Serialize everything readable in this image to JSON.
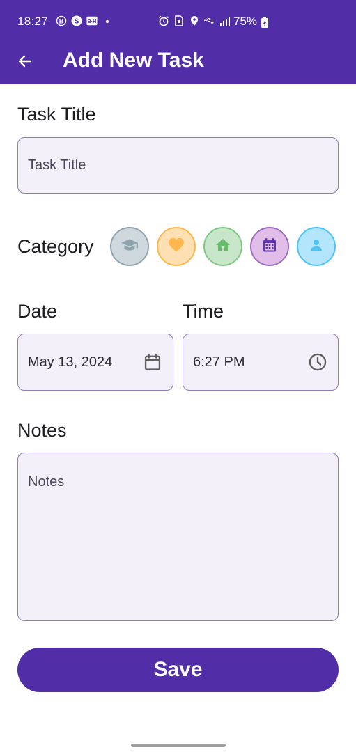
{
  "status_bar": {
    "time": "18:27",
    "battery": "75%",
    "left_icons": [
      "b-circle-icon",
      "s-circle-icon",
      "bh-box-icon",
      "dot-icon"
    ],
    "right_icons": [
      "alarm-icon",
      "sim-lock-icon",
      "location-icon",
      "4g-icon",
      "signal-icon"
    ]
  },
  "app_bar": {
    "title": "Add New Task",
    "back_icon": "arrow-left-icon"
  },
  "task_title": {
    "label": "Task Title",
    "placeholder": "Task Title"
  },
  "category": {
    "label": "Category",
    "options": [
      {
        "name": "education",
        "icon": "graduation-cap-icon",
        "bg": "#cfd8dc",
        "border": "#90a4ae",
        "icon_color": "#90a4ae"
      },
      {
        "name": "health",
        "icon": "heart-icon",
        "bg": "#ffe0b2",
        "border": "#ffb74d",
        "icon_color": "#ffb74d"
      },
      {
        "name": "home",
        "icon": "home-icon",
        "bg": "#c8e6c9",
        "border": "#81c784",
        "icon_color": "#66bb6a"
      },
      {
        "name": "calendar",
        "icon": "calendar-icon",
        "bg": "#e1bee7",
        "border": "#9c6bbf",
        "icon_color": "#5e35b1"
      },
      {
        "name": "personal",
        "icon": "person-icon",
        "bg": "#b3e5fc",
        "border": "#4fc3f7",
        "icon_color": "#4fc3f7"
      }
    ]
  },
  "date": {
    "label": "Date",
    "value": "May 13, 2024",
    "icon": "calendar-icon"
  },
  "time": {
    "label": "Time",
    "value": "6:27 PM",
    "icon": "clock-icon"
  },
  "notes": {
    "label": "Notes",
    "placeholder": "Notes"
  },
  "save_button": {
    "label": "Save"
  },
  "colors": {
    "primary": "#512da8",
    "field_bg": "#f3f0f9",
    "field_border": "#8e7cc3"
  }
}
